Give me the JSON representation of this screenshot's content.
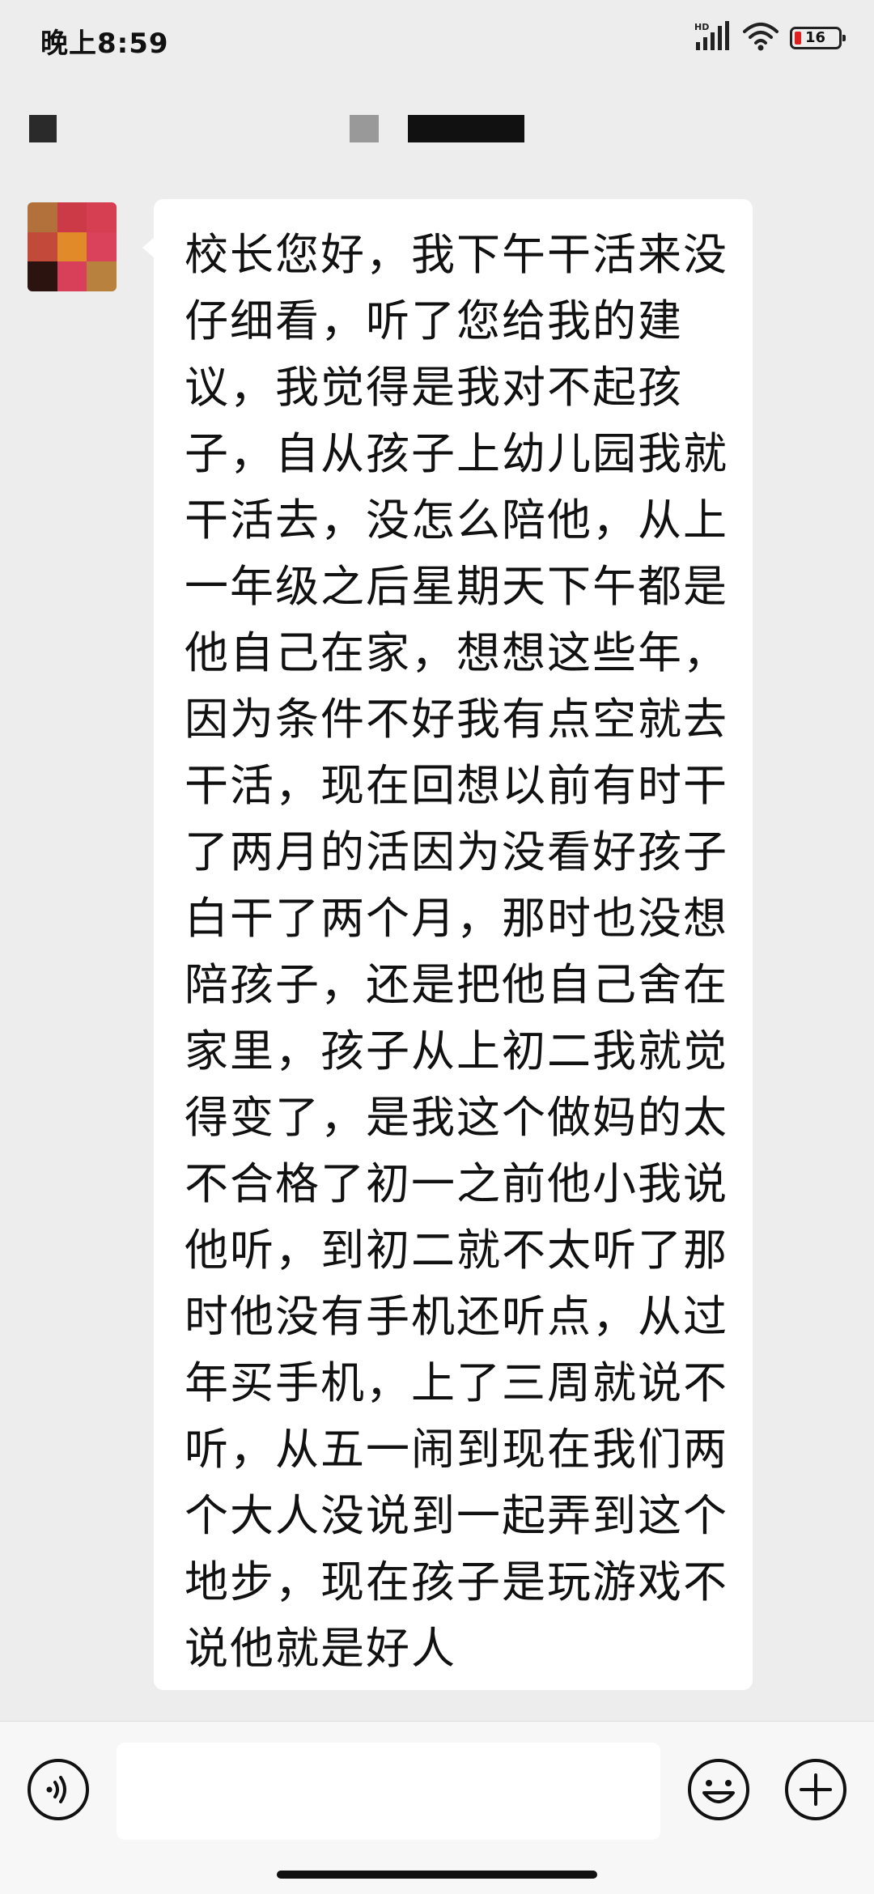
{
  "status_bar": {
    "time": "晚上8:59",
    "battery_level": "16",
    "icons": [
      "hd-signal-icon",
      "wifi-icon",
      "battery-icon"
    ]
  },
  "header": {
    "title": "",
    "redacted": true
  },
  "messages": [
    {
      "sender": "other",
      "avatar": "pixelated-avatar",
      "text": "校长您好，我下午干活来没仔细看，听了您给我的建议，我觉得是我对不起孩子，自从孩子上幼儿园我就干活去，没怎么陪他，从上一年级之后星期天下午都是他自己在家，想想这些年，因为条件不好我有点空就去干活，现在回想以前有时干了两月的活因为没看好孩子白干了两个月，那时也没想陪孩子，还是把他自己舍在家里，孩子从上初二我就觉得变了，是我这个做妈的太不合格了初一之前他小我说他听，到初二就不太听了那时他没有手机还听点，从过年买手机，上了三周就说不听，从五一闹到现在我们两个大人没说到一起弄到这个地步，现在孩子是玩游戏不说他就是好人"
    }
  ],
  "input_bar": {
    "input_value": "",
    "icons": [
      "voice-icon",
      "emoji-icon",
      "plus-icon"
    ]
  },
  "colors": {
    "background": "#ededed",
    "bubble": "#ffffff",
    "battery_low": "#e02020"
  }
}
